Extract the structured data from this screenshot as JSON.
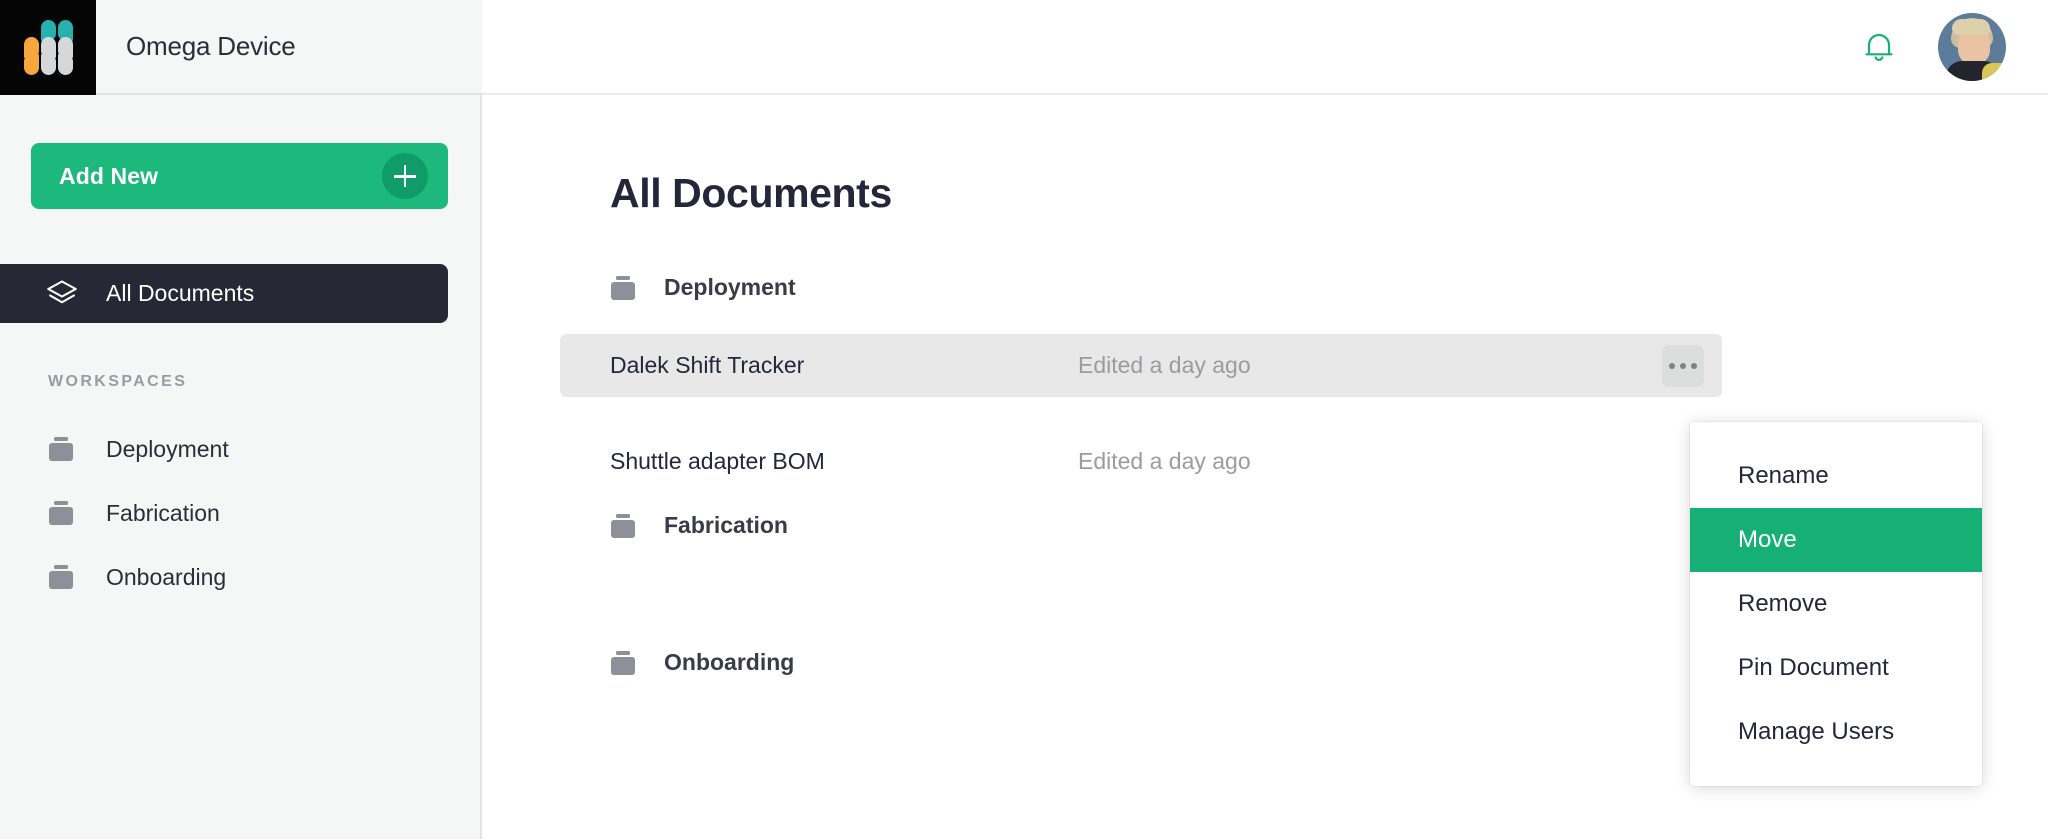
{
  "app": {
    "workspace_title": "Omega Device",
    "logo_name": "app-logo",
    "logo_colors": {
      "teal": "#26b0ae",
      "orange": "#f5a63c",
      "gray": "#d5d7d8",
      "background": "#050505"
    }
  },
  "sidebar": {
    "add_new_label": "Add New",
    "add_new_icon": "plus-icon",
    "nav": {
      "all_documents_label": "All Documents",
      "all_documents_icon": "layers-icon"
    },
    "workspaces_header": "WORKSPACES",
    "workspaces": [
      {
        "label": "Deployment",
        "icon": "briefcase-icon"
      },
      {
        "label": "Fabrication",
        "icon": "briefcase-icon"
      },
      {
        "label": "Onboarding",
        "icon": "briefcase-icon"
      }
    ]
  },
  "topbar": {
    "notification_icon": "bell-icon",
    "avatar_icon": "user-avatar"
  },
  "main": {
    "page_title": "All Documents",
    "sections": [
      {
        "label": "Deployment",
        "icon": "briefcase-icon",
        "documents": [
          {
            "name": "Dalek Shift Tracker",
            "meta": "Edited a day ago",
            "selected": true
          },
          {
            "name": "Shuttle adapter BOM",
            "meta": "Edited a day ago",
            "selected": false
          }
        ]
      },
      {
        "label": "Fabrication",
        "icon": "briefcase-icon",
        "documents": []
      },
      {
        "label": "Onboarding",
        "icon": "briefcase-icon",
        "documents": []
      }
    ],
    "row_menu_icon": "ellipsis-icon"
  },
  "context_menu": {
    "items": [
      {
        "label": "Rename",
        "active": false
      },
      {
        "label": "Move",
        "active": true
      },
      {
        "label": "Remove",
        "active": false
      },
      {
        "label": "Pin Document",
        "active": false
      },
      {
        "label": "Manage Users",
        "active": false
      }
    ]
  },
  "colors": {
    "accent_green": "#16b077",
    "button_green": "#1cb87c",
    "plus_green": "#0f9c68",
    "sidebar_bg": "#f5f6f6",
    "nav_active_bg": "#272836",
    "text_dark": "#24263a",
    "text_muted": "#9a9ba4",
    "row_selected_bg": "#e8e8e9"
  }
}
